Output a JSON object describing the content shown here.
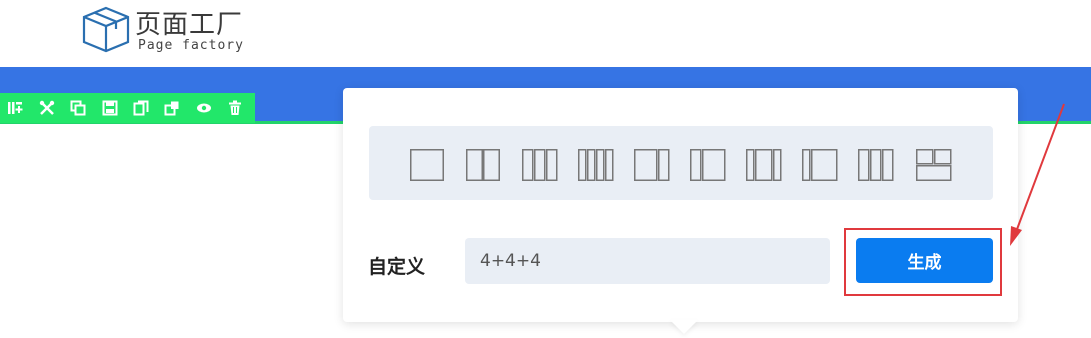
{
  "logo": {
    "title": "页面工厂",
    "subtitle": "Page factory",
    "icon": "cube-box-icon"
  },
  "toolbar": {
    "items": [
      {
        "name": "layout-add-icon"
      },
      {
        "name": "tools-icon"
      },
      {
        "name": "copy-icon"
      },
      {
        "name": "save-icon"
      },
      {
        "name": "duplicate-icon"
      },
      {
        "name": "export-icon"
      },
      {
        "name": "eye-icon"
      },
      {
        "name": "trash-icon"
      }
    ]
  },
  "layouts": [
    {
      "name": "layout-1-col",
      "cols": 1
    },
    {
      "name": "layout-2-col",
      "cols": 2
    },
    {
      "name": "layout-3-col",
      "cols": 3
    },
    {
      "name": "layout-4-col",
      "cols": 4
    },
    {
      "name": "layout-wide-narrow",
      "cols": 2
    },
    {
      "name": "layout-narrow-wide",
      "cols": 2
    },
    {
      "name": "layout-1-2-1",
      "cols": 3
    },
    {
      "name": "layout-narrow-wide-b",
      "cols": 2
    },
    {
      "name": "layout-3-col-b",
      "cols": 3
    },
    {
      "name": "layout-2x2-grid",
      "cols": 4
    }
  ],
  "custom": {
    "label": "自定义",
    "input_value": "4+4+4",
    "button_label": "生成"
  },
  "colors": {
    "header_blue": "#3674e4",
    "toolbar_green": "#22e76a",
    "button_blue": "#0a7cf0",
    "annotation_red": "#e0393d"
  }
}
